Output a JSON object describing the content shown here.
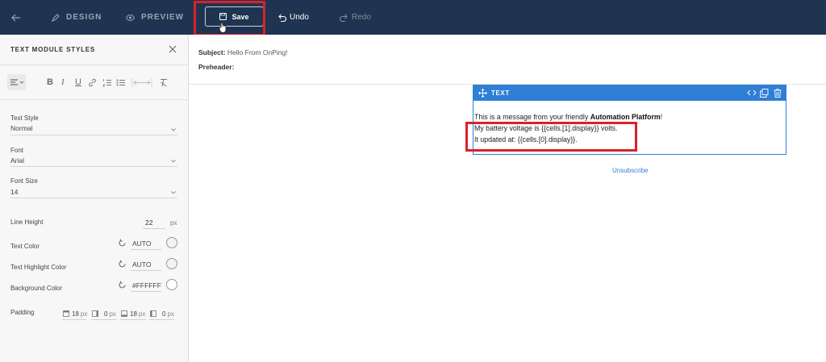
{
  "topbar": {
    "back_icon": "arrow-left-icon",
    "design_label": "DESIGN",
    "preview_label": "PREVIEW",
    "save_label": "Save",
    "undo_label": "Undo",
    "redo_label": "Redo"
  },
  "panel": {
    "title": "TEXT MODULE STYLES",
    "fields": {
      "text_style": {
        "label": "Text Style",
        "value": "Normal"
      },
      "font": {
        "label": "Font",
        "value": "Arial"
      },
      "font_size": {
        "label": "Font Size",
        "value": "14"
      },
      "line_height": {
        "label": "Line Height",
        "value": "22",
        "unit": "px"
      },
      "text_color": {
        "label": "Text Color",
        "value": "AUTO"
      },
      "text_highlight_color": {
        "label": "Text Highlight Color",
        "value": "AUTO"
      },
      "background_color": {
        "label": "Background Color",
        "value": "#FFFFFF"
      },
      "padding": {
        "label": "Padding",
        "top": "18",
        "right": "0",
        "bottom": "18",
        "left": "0",
        "unit": "px"
      }
    }
  },
  "email": {
    "subject_label": "Subject:",
    "subject_value": "Hello From OnPing!",
    "preheader_label": "Preheader:",
    "module_title": "TEXT",
    "line1_prefix": "This is a message from your friendly ",
    "line1_bold": "Automation Platform",
    "line1_suffix": "!",
    "line2": "My battery voltage is {{cells.[1].display}} volts.",
    "line3": "It updated at: {{cells.[0].display}}.",
    "unsubscribe": "Unsubscribe"
  },
  "colors": {
    "topbar_bg": "#1f3450",
    "accent_blue": "#2f7fd6",
    "highlight_red": "#d9222a"
  }
}
